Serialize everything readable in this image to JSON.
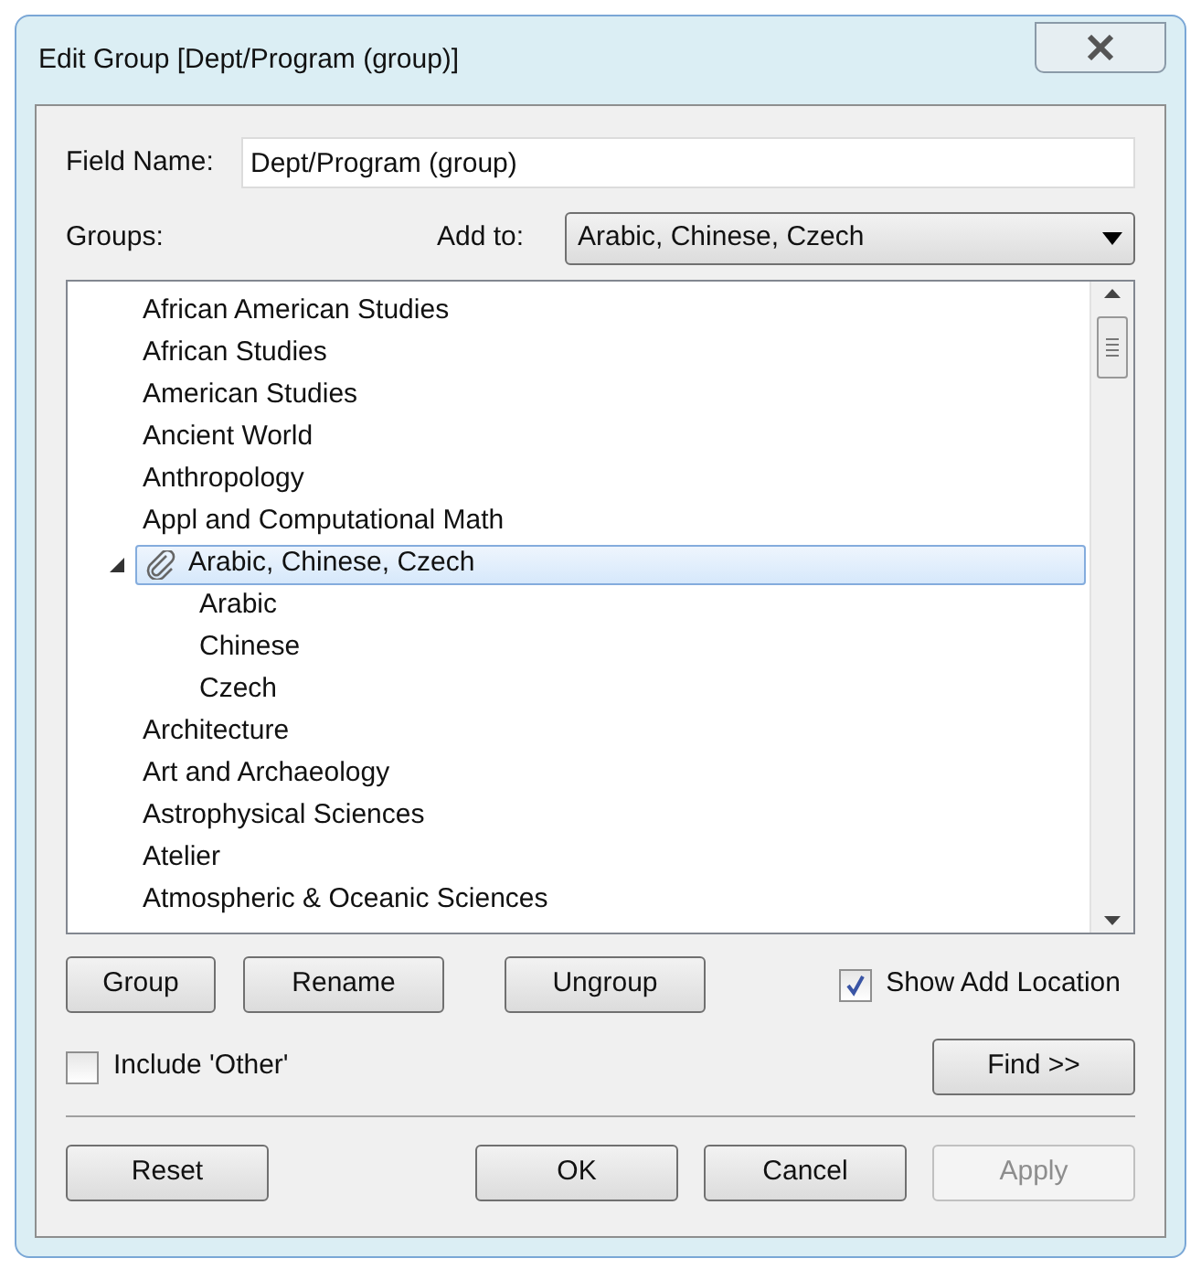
{
  "window": {
    "title": "Edit Group [Dept/Program (group)]"
  },
  "field_name": {
    "label": "Field Name:",
    "value": "Dept/Program (group)"
  },
  "groups_label": "Groups:",
  "add_to": {
    "label": "Add to:",
    "value": "Arabic, Chinese, Czech"
  },
  "tree": [
    {
      "label": "African American Studies",
      "selected": false
    },
    {
      "label": "African Studies",
      "selected": false
    },
    {
      "label": "American Studies",
      "selected": false
    },
    {
      "label": "Ancient World",
      "selected": false
    },
    {
      "label": "Anthropology",
      "selected": false
    },
    {
      "label": "Appl and Computational Math",
      "selected": false
    },
    {
      "label": "Arabic, Chinese, Czech",
      "selected": true,
      "expanded": true,
      "children": [
        {
          "label": "Arabic",
          "selected": false
        },
        {
          "label": "Chinese",
          "selected": false
        },
        {
          "label": "Czech",
          "selected": false
        }
      ]
    },
    {
      "label": "Architecture",
      "selected": false
    },
    {
      "label": "Art and Archaeology",
      "selected": false
    },
    {
      "label": "Astrophysical Sciences",
      "selected": false
    },
    {
      "label": "Atelier",
      "selected": false
    },
    {
      "label": "Atmospheric & Oceanic Sciences",
      "selected": false
    }
  ],
  "group_buttons": [
    "Group",
    "Rename",
    "Ungroup"
  ],
  "show_add_location": {
    "label": "Show Add Location",
    "checked": true
  },
  "include_other": {
    "label": "Include 'Other'",
    "checked": false
  },
  "find_button": "Find >>",
  "buttons": [
    {
      "label": "Reset",
      "disabled": false
    },
    {
      "label": "OK",
      "disabled": false
    },
    {
      "label": "Cancel",
      "disabled": false
    },
    {
      "label": "Apply",
      "disabled": true
    }
  ]
}
